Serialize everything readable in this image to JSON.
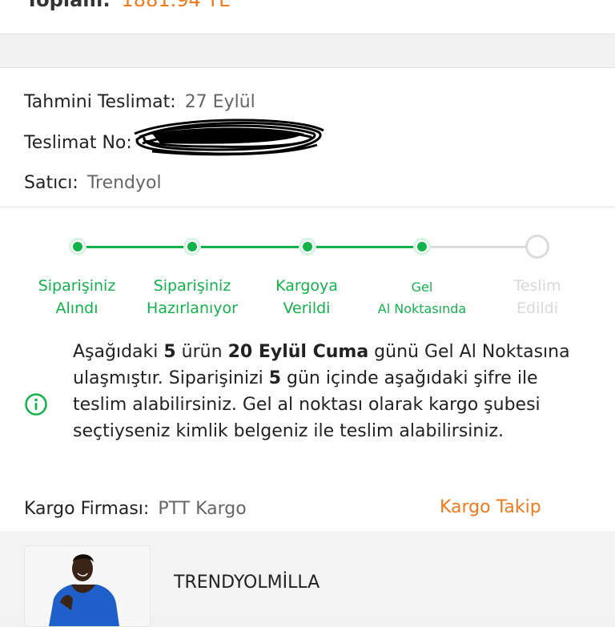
{
  "order_summary": {
    "total_label": "Toplam:",
    "total_value": "1881.94 TL"
  },
  "delivery": {
    "estimated_label": "Tahmini Teslimat:",
    "estimated_value": "27 Eylül",
    "number_label": "Teslimat No:",
    "seller_label": "Satıcı:",
    "seller_value": "Trendyol"
  },
  "progress": {
    "steps": [
      {
        "line1": "Siparişiniz",
        "line2": "Alındı",
        "status": "done"
      },
      {
        "line1": "Siparişiniz",
        "line2": "Hazırlanıyor",
        "status": "done"
      },
      {
        "line1": "Kargoya",
        "line2": "Verildi",
        "status": "done"
      },
      {
        "line1": "Gel",
        "line2": "Al Noktasında",
        "status": "done"
      },
      {
        "line1": "Teslim",
        "line2": "Edildi",
        "status": "pending"
      }
    ],
    "active_color": "#13b34b",
    "inactive_color": "#dcdcdc"
  },
  "notice": {
    "icon": "info-circle-icon",
    "p1": "Aşağıdaki ",
    "b1": "5",
    "p2": " ürün ",
    "b2": "20 Eylül Cuma",
    "p3": " günü Gel Al Noktasına ulaşmıştır. Siparişinizi ",
    "b3": "5",
    "p4": " gün içinde aşağıdaki şifre ile teslim alabilirsiniz. Gel al noktası olarak kargo şubesi seçtiyseniz kimlik belgeniz ile teslim alabilirsiniz."
  },
  "cargo": {
    "company_label": "Kargo Firması:",
    "company_value": "PTT Kargo",
    "track_label": "Kargo Takip"
  },
  "product": {
    "brand": "TRENDYOLMİLLA"
  },
  "colors": {
    "brand_orange": "#f27a1a",
    "success_green": "#13b34b"
  }
}
